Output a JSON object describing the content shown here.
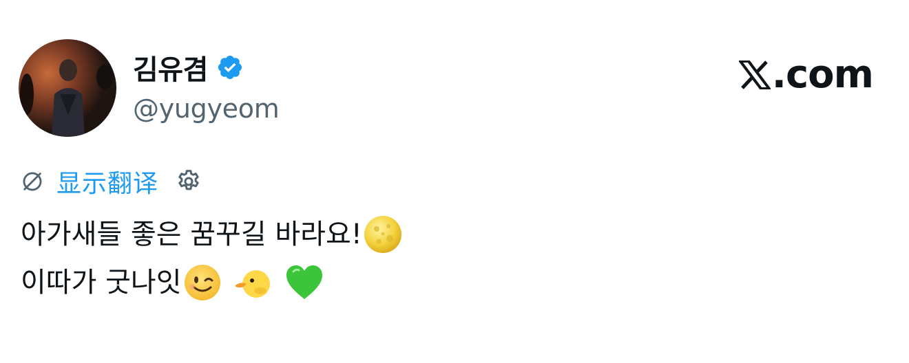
{
  "author": {
    "display_name": "김유겸",
    "handle": "@yugyeom",
    "verified": true,
    "avatar": "profile-photo"
  },
  "site": {
    "label": ".com",
    "logo_icon": "x-logo-icon"
  },
  "translate": {
    "label": "显示翻译",
    "globe_icon": "globe-icon",
    "settings_icon": "gear-icon"
  },
  "tweet": {
    "line1_text": "아가새들 좋은 꿈꾸길 바라요!",
    "line1_emoji": "full-moon-face-emoji",
    "line2_text": "이따가 굿나잇",
    "line2_emojis": [
      "winking-face-emoji",
      "duck-emoji",
      "green-heart-emoji"
    ]
  },
  "colors": {
    "link": "#1d9bf0",
    "verified": "#1d9bf0",
    "secondary_text": "#536471",
    "primary_text": "#0f1419"
  }
}
